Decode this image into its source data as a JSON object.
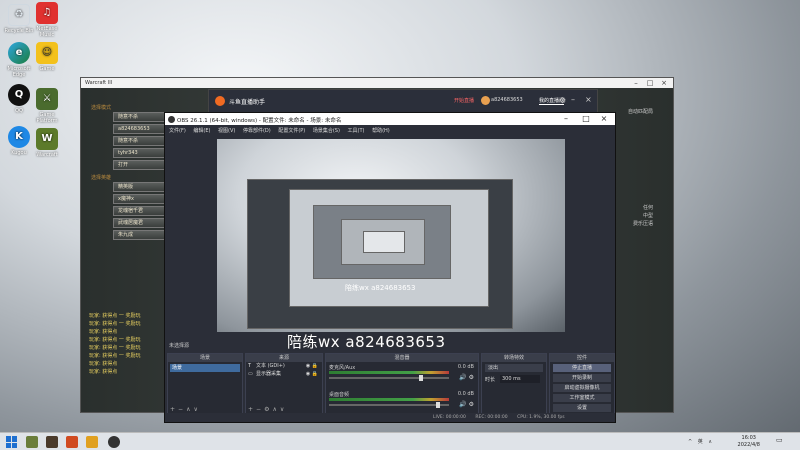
{
  "desktop": {
    "icons": [
      {
        "label": "Recycle Bin"
      },
      {
        "label": "Microsoft Edge"
      },
      {
        "label": "QQ"
      },
      {
        "label": "Kugou"
      },
      {
        "label": "NetEase Music"
      },
      {
        "label": "Game"
      },
      {
        "label": "Game Platform"
      },
      {
        "label": "Warcraft"
      }
    ]
  },
  "game_window": {
    "title": "Warcraft III",
    "section_top": "选择模式",
    "section_mid": "选择英雄",
    "top_buttons": [
      "随意不杀",
      "a824683653",
      "随意不杀",
      "tyhr343",
      "打开"
    ],
    "mid_buttons": [
      "精英版",
      "x魔神x",
      "龙魂宿千君",
      "武魂居魔君",
      "朱九成"
    ],
    "chat_lines": [
      "玩家: 获得点 一 奖励玩",
      "玩家: 获得点 一 奖励玩",
      "玩家: 获得点",
      "玩家: 获得点 一 奖励玩",
      "玩家: 获得点 一 奖励玩",
      "玩家: 获得点 一 奖励玩",
      "玩家: 获得点",
      "玩家: 获得点"
    ],
    "right_top": "自动匹配局",
    "right_lines": [
      "任何",
      "中型",
      "费乐压语"
    ]
  },
  "douyu": {
    "title": "斗鱼直播助手",
    "live_label": "开始直播",
    "user": "a824683653",
    "link": "我的直播间"
  },
  "obs": {
    "title": "OBS 26.1.1 (64-bit, windows) - 配置文件: 未命名 - 场景: 未命名",
    "menu": [
      "文件(F)",
      "编辑(E)",
      "视图(V)",
      "停靠部件(D)",
      "配置文件(P)",
      "场景集合(S)",
      "工具(T)",
      "帮助(H)"
    ],
    "overlay_text": "陪练wx  a824683653",
    "nested_overlay_text": "陪练wx  a824683653",
    "scene_label": "未选择源",
    "docks": {
      "scenes": {
        "title": "场景",
        "items": [
          "场景"
        ]
      },
      "sources": {
        "title": "来源",
        "items": [
          {
            "name": "文本 (GDI+)"
          },
          {
            "name": "显示器采集"
          }
        ]
      },
      "mixer": {
        "title": "混音器",
        "channels": [
          {
            "name": "麦克风/Aux",
            "db": "0.0 dB",
            "level": 0.78
          },
          {
            "name": "桌面音频",
            "db": "0.0 dB",
            "level": 0.92
          }
        ]
      },
      "transitions": {
        "title": "转场特效",
        "fade": "淡出",
        "duration_label": "时长",
        "duration": "300 ms"
      },
      "controls": {
        "title": "控件",
        "buttons": [
          "停止直播",
          "开始录制",
          "启动虚拟摄像机",
          "工作室模式",
          "设置",
          "退出"
        ]
      }
    },
    "status": [
      "LIVE: 00:00:00",
      "REC: 00:00:00",
      "CPU: 1.9%, 30.00 fps"
    ]
  },
  "taskbar": {
    "clock_time": "16:03",
    "clock_date": "2022/4/8",
    "tray": "^ 英 ∧"
  }
}
